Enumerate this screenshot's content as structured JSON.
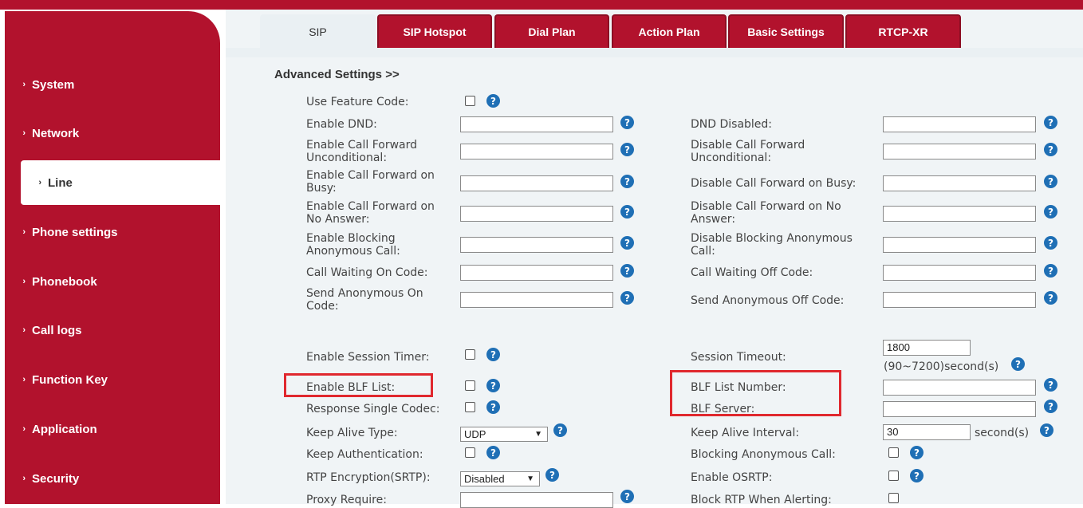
{
  "sidebar": {
    "items": [
      {
        "label": "System"
      },
      {
        "label": "Network"
      },
      {
        "label": "Line",
        "active": true
      },
      {
        "label": "Phone settings"
      },
      {
        "label": "Phonebook"
      },
      {
        "label": "Call logs"
      },
      {
        "label": "Function Key"
      },
      {
        "label": "Application"
      },
      {
        "label": "Security"
      }
    ]
  },
  "tabs": [
    {
      "label": "SIP",
      "active": true
    },
    {
      "label": "SIP Hotspot"
    },
    {
      "label": "Dial Plan"
    },
    {
      "label": "Action Plan"
    },
    {
      "label": "Basic Settings"
    },
    {
      "label": "RTCP-XR"
    }
  ],
  "section_title": "Advanced Settings >>",
  "fields": {
    "use_feature_code": "Use Feature Code:",
    "enable_dnd": "Enable DND:",
    "dnd_disabled": "DND Disabled:",
    "enable_cfu_1": "Enable Call Forward",
    "enable_cfu_2": "Unconditional:",
    "disable_cfu_1": "Disable Call Forward",
    "disable_cfu_2": "Unconditional:",
    "enable_cfb_1": "Enable Call Forward on",
    "enable_cfb_2": "Busy:",
    "disable_cfb": "Disable Call Forward on Busy:",
    "enable_cfna_1": "Enable Call Forward on",
    "enable_cfna_2": "No Answer:",
    "disable_cfna_1": "Disable Call Forward on No",
    "disable_cfna_2": "Answer:",
    "enable_block_1": "Enable Blocking",
    "enable_block_2": "Anonymous Call:",
    "disable_block_1": "Disable Blocking Anonymous",
    "disable_block_2": "Call:",
    "cw_on": "Call Waiting On Code:",
    "cw_off": "Call Waiting Off Code:",
    "send_anon_on_1": "Send Anonymous On",
    "send_anon_on_2": "Code:",
    "send_anon_off": "Send Anonymous Off Code:",
    "enable_session_timer": "Enable Session Timer:",
    "session_timeout": "Session Timeout:",
    "session_timeout_value": "1800",
    "session_timeout_range": "(90~7200)second(s)",
    "enable_blf_list": "Enable BLF List:",
    "blf_list_number": "BLF List Number:",
    "response_single_codec": "Response Single Codec:",
    "blf_server": "BLF Server:",
    "keep_alive_type": "Keep Alive Type:",
    "keep_alive_type_value": "UDP",
    "keep_alive_interval": "Keep Alive Interval:",
    "keep_alive_interval_value": "30",
    "keep_alive_unit": "second(s)",
    "keep_authentication": "Keep Authentication:",
    "blocking_anonymous_call": "Blocking Anonymous Call:",
    "rtp_encryption": "RTP Encryption(SRTP):",
    "rtp_encryption_value": "Disabled",
    "enable_osrtp": "Enable OSRTP:",
    "proxy_require": "Proxy Require:",
    "block_rtp_alerting": "Block RTP When Alerting:"
  },
  "help_glyph": "?",
  "colors": {
    "brand_red": "#b2122d",
    "help_blue": "#1f6fb5",
    "highlight_red": "#e0282e"
  }
}
